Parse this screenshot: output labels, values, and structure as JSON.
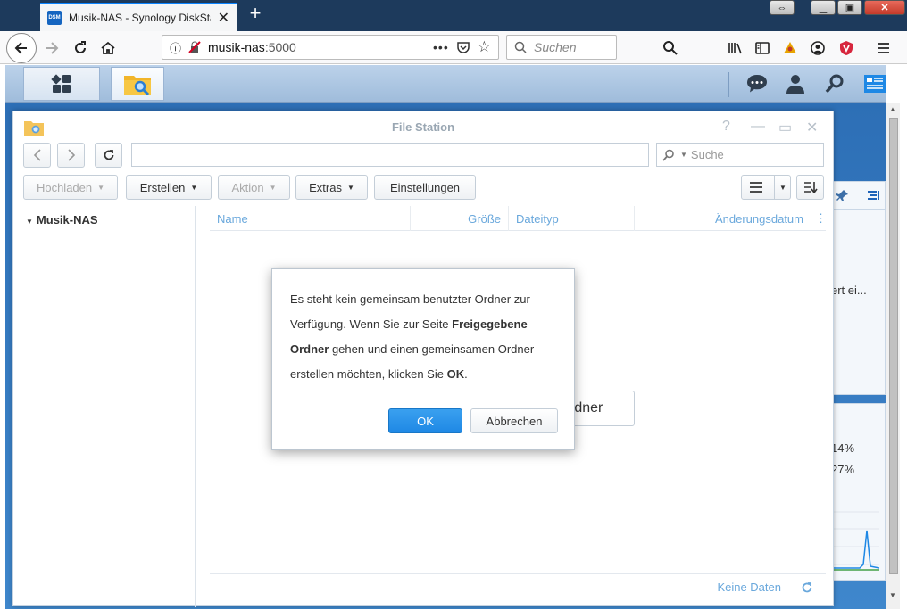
{
  "browser": {
    "tab_title": "Musik-NAS - Synology DiskStat",
    "favicon_text": "DSM",
    "url_host": "musik-nas",
    "url_port": ":5000",
    "search_placeholder": "Suchen"
  },
  "file_station": {
    "title": "File Station",
    "search_placeholder": "Suche",
    "toolbar": {
      "upload": "Hochladen",
      "create": "Erstellen",
      "action": "Aktion",
      "extras": "Extras",
      "settings": "Einstellungen"
    },
    "tree_root": "Musik-NAS",
    "columns": {
      "name": "Name",
      "size": "Größe",
      "type": "Dateityp",
      "modified": "Änderungsdatum"
    },
    "footer": "Keine Daten",
    "behind_button_fragment": "rdner"
  },
  "widgets": {
    "text_fragment": "ert ei...",
    "pct1": "14%",
    "pct2": "27%"
  },
  "dialog": {
    "line1": "Es steht kein gemeinsam benutzter Ordner zur",
    "line2a": "Verfügung. Wenn Sie zur Seite ",
    "line2b": "Freigegebene",
    "line3a": "Ordner",
    "line3b": " gehen und einen gemeinsamen Ordner",
    "line4a": "erstellen möchten, klicken Sie ",
    "line4b": "OK",
    "line4c": ".",
    "ok": "OK",
    "cancel": "Abbrechen"
  }
}
